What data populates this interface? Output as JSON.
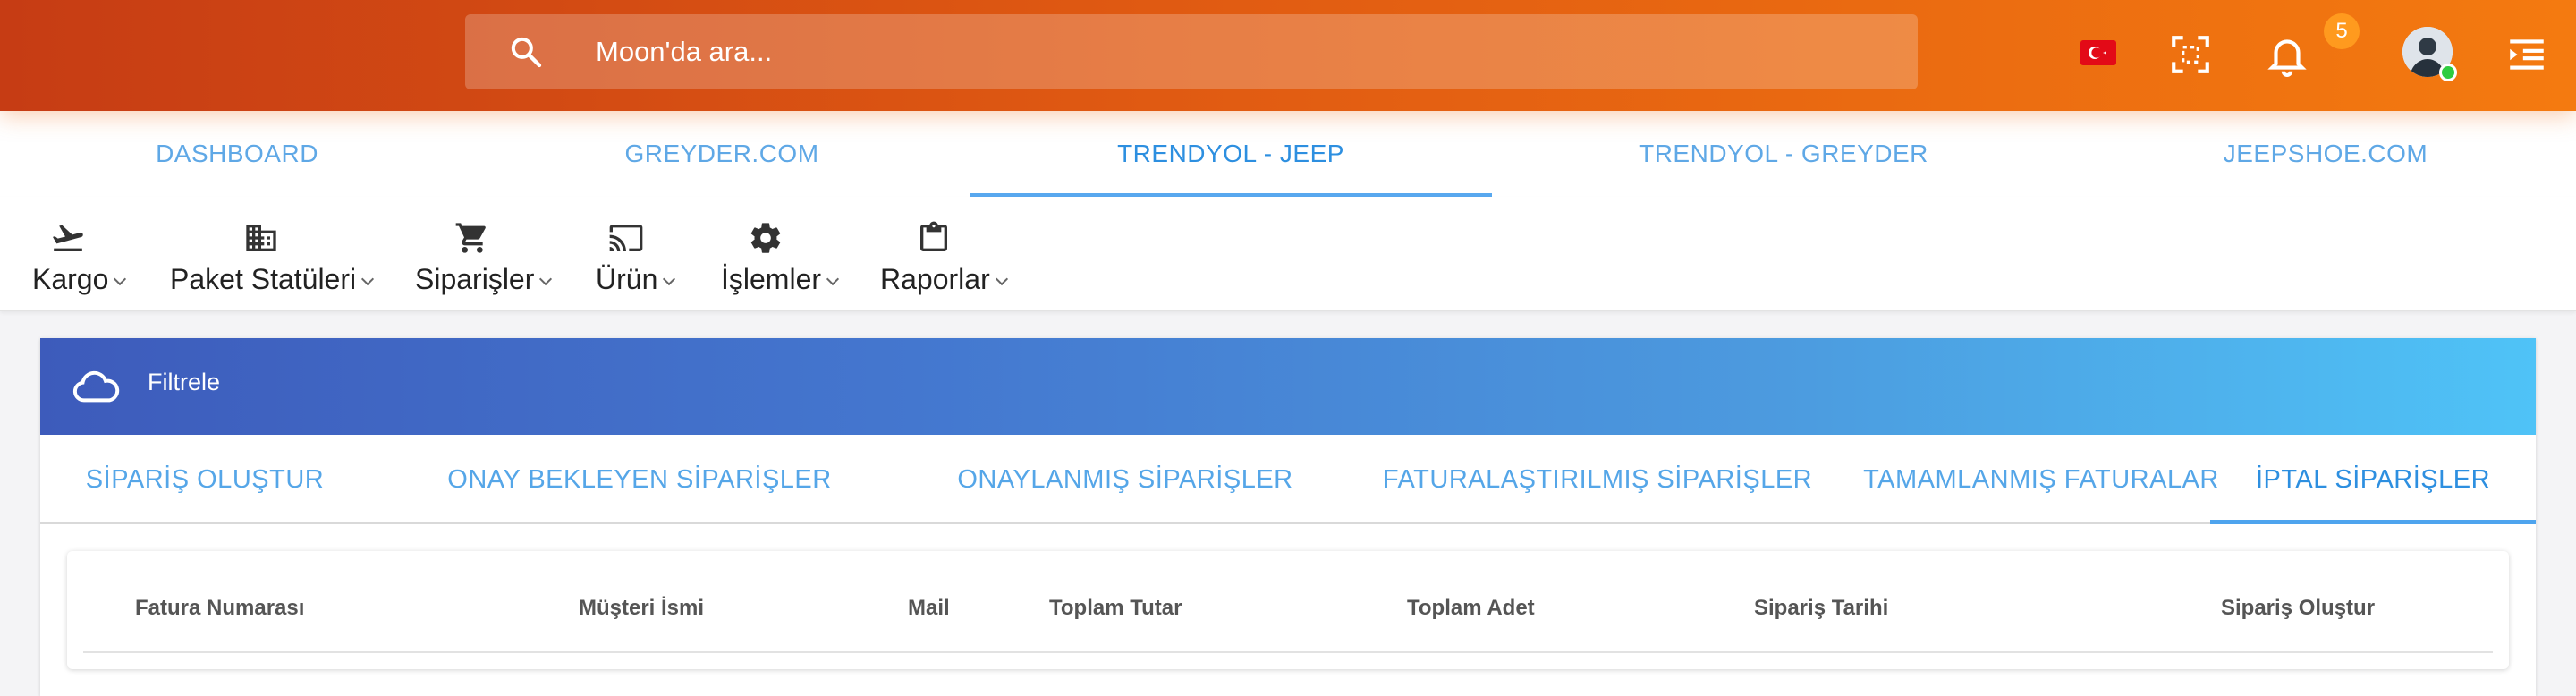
{
  "topbar": {
    "search_placeholder": "Moon'da ara...",
    "notification_count": "5",
    "icons": [
      "search-icon",
      "turkey-flag-icon",
      "fullscreen-icon",
      "bell-icon",
      "avatar",
      "menu-collapse-icon"
    ]
  },
  "nav_tabs": [
    {
      "label": "DASHBOARD",
      "active": false
    },
    {
      "label": "GREYDER.COM",
      "active": false
    },
    {
      "label": "TRENDYOL - JEEP",
      "active": true
    },
    {
      "label": "TRENDYOL - GREYDER",
      "active": false
    },
    {
      "label": "JEEPSHOE.COM",
      "active": false
    }
  ],
  "menu": [
    {
      "label": "Kargo",
      "icon": "flight-takeoff-icon"
    },
    {
      "label": "Paket Statüleri",
      "icon": "building-icon"
    },
    {
      "label": "Siparişler",
      "icon": "cart-icon"
    },
    {
      "label": "Ürün",
      "icon": "cast-icon"
    },
    {
      "label": "İşlemler",
      "icon": "gear-icon"
    },
    {
      "label": "Raporlar",
      "icon": "clipboard-icon"
    }
  ],
  "card": {
    "title": "Filtrele",
    "icon": "cloud-icon",
    "tabs": [
      {
        "label": "SİPARİŞ OLUŞTUR",
        "active": false
      },
      {
        "label": "ONAY BEKLEYEN SİPARİŞLER",
        "active": false
      },
      {
        "label": "ONAYLANMIŞ SİPARİŞLER",
        "active": false
      },
      {
        "label": "FATURALAŞTIRILMIŞ SİPARİŞLER",
        "active": false
      },
      {
        "label": "TAMAMLANMIŞ FATURALAR",
        "active": false
      },
      {
        "label": "İPTAL SİPARİŞLER",
        "active": true
      }
    ],
    "table_headers": [
      "Fatura Numarası",
      "Müşteri İsmi",
      "Mail",
      "Toplam Tutar",
      "Toplam Adet",
      "Sipariş Tarihi",
      "Sipariş Oluştur"
    ]
  },
  "colors": {
    "topbar_start": "#c63c14",
    "topbar_end": "#f47a10",
    "accent_blue": "#2d8fe0",
    "header_gradient_start": "#3d5bbb",
    "header_gradient_end": "#4fc3f7"
  }
}
